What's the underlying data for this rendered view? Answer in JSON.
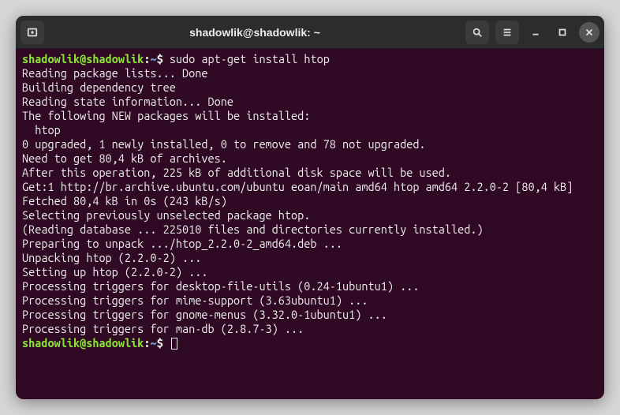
{
  "title": "shadowlik@shadowlik: ~",
  "prompt": {
    "user": "shadowlik",
    "at": "@",
    "host": "shadowlik",
    "colon": ":",
    "path": "~",
    "dollar": "$"
  },
  "command": "sudo apt-get install htop",
  "output": [
    "Reading package lists... Done",
    "Building dependency tree",
    "Reading state information... Done",
    "The following NEW packages will be installed:",
    "  htop",
    "0 upgraded, 1 newly installed, 0 to remove and 78 not upgraded.",
    "Need to get 80,4 kB of archives.",
    "After this operation, 225 kB of additional disk space will be used.",
    "Get:1 http://br.archive.ubuntu.com/ubuntu eoan/main amd64 htop amd64 2.2.0-2 [80,4 kB]",
    "Fetched 80,4 kB in 0s (243 kB/s)",
    "Selecting previously unselected package htop.",
    "(Reading database ... 225010 files and directories currently installed.)",
    "Preparing to unpack .../htop_2.2.0-2_amd64.deb ...",
    "Unpacking htop (2.2.0-2) ...",
    "Setting up htop (2.2.0-2) ...",
    "Processing triggers for desktop-file-utils (0.24-1ubuntu1) ...",
    "Processing triggers for mime-support (3.63ubuntu1) ...",
    "Processing triggers for gnome-menus (3.32.0-1ubuntu1) ...",
    "Processing triggers for man-db (2.8.7-3) ..."
  ]
}
